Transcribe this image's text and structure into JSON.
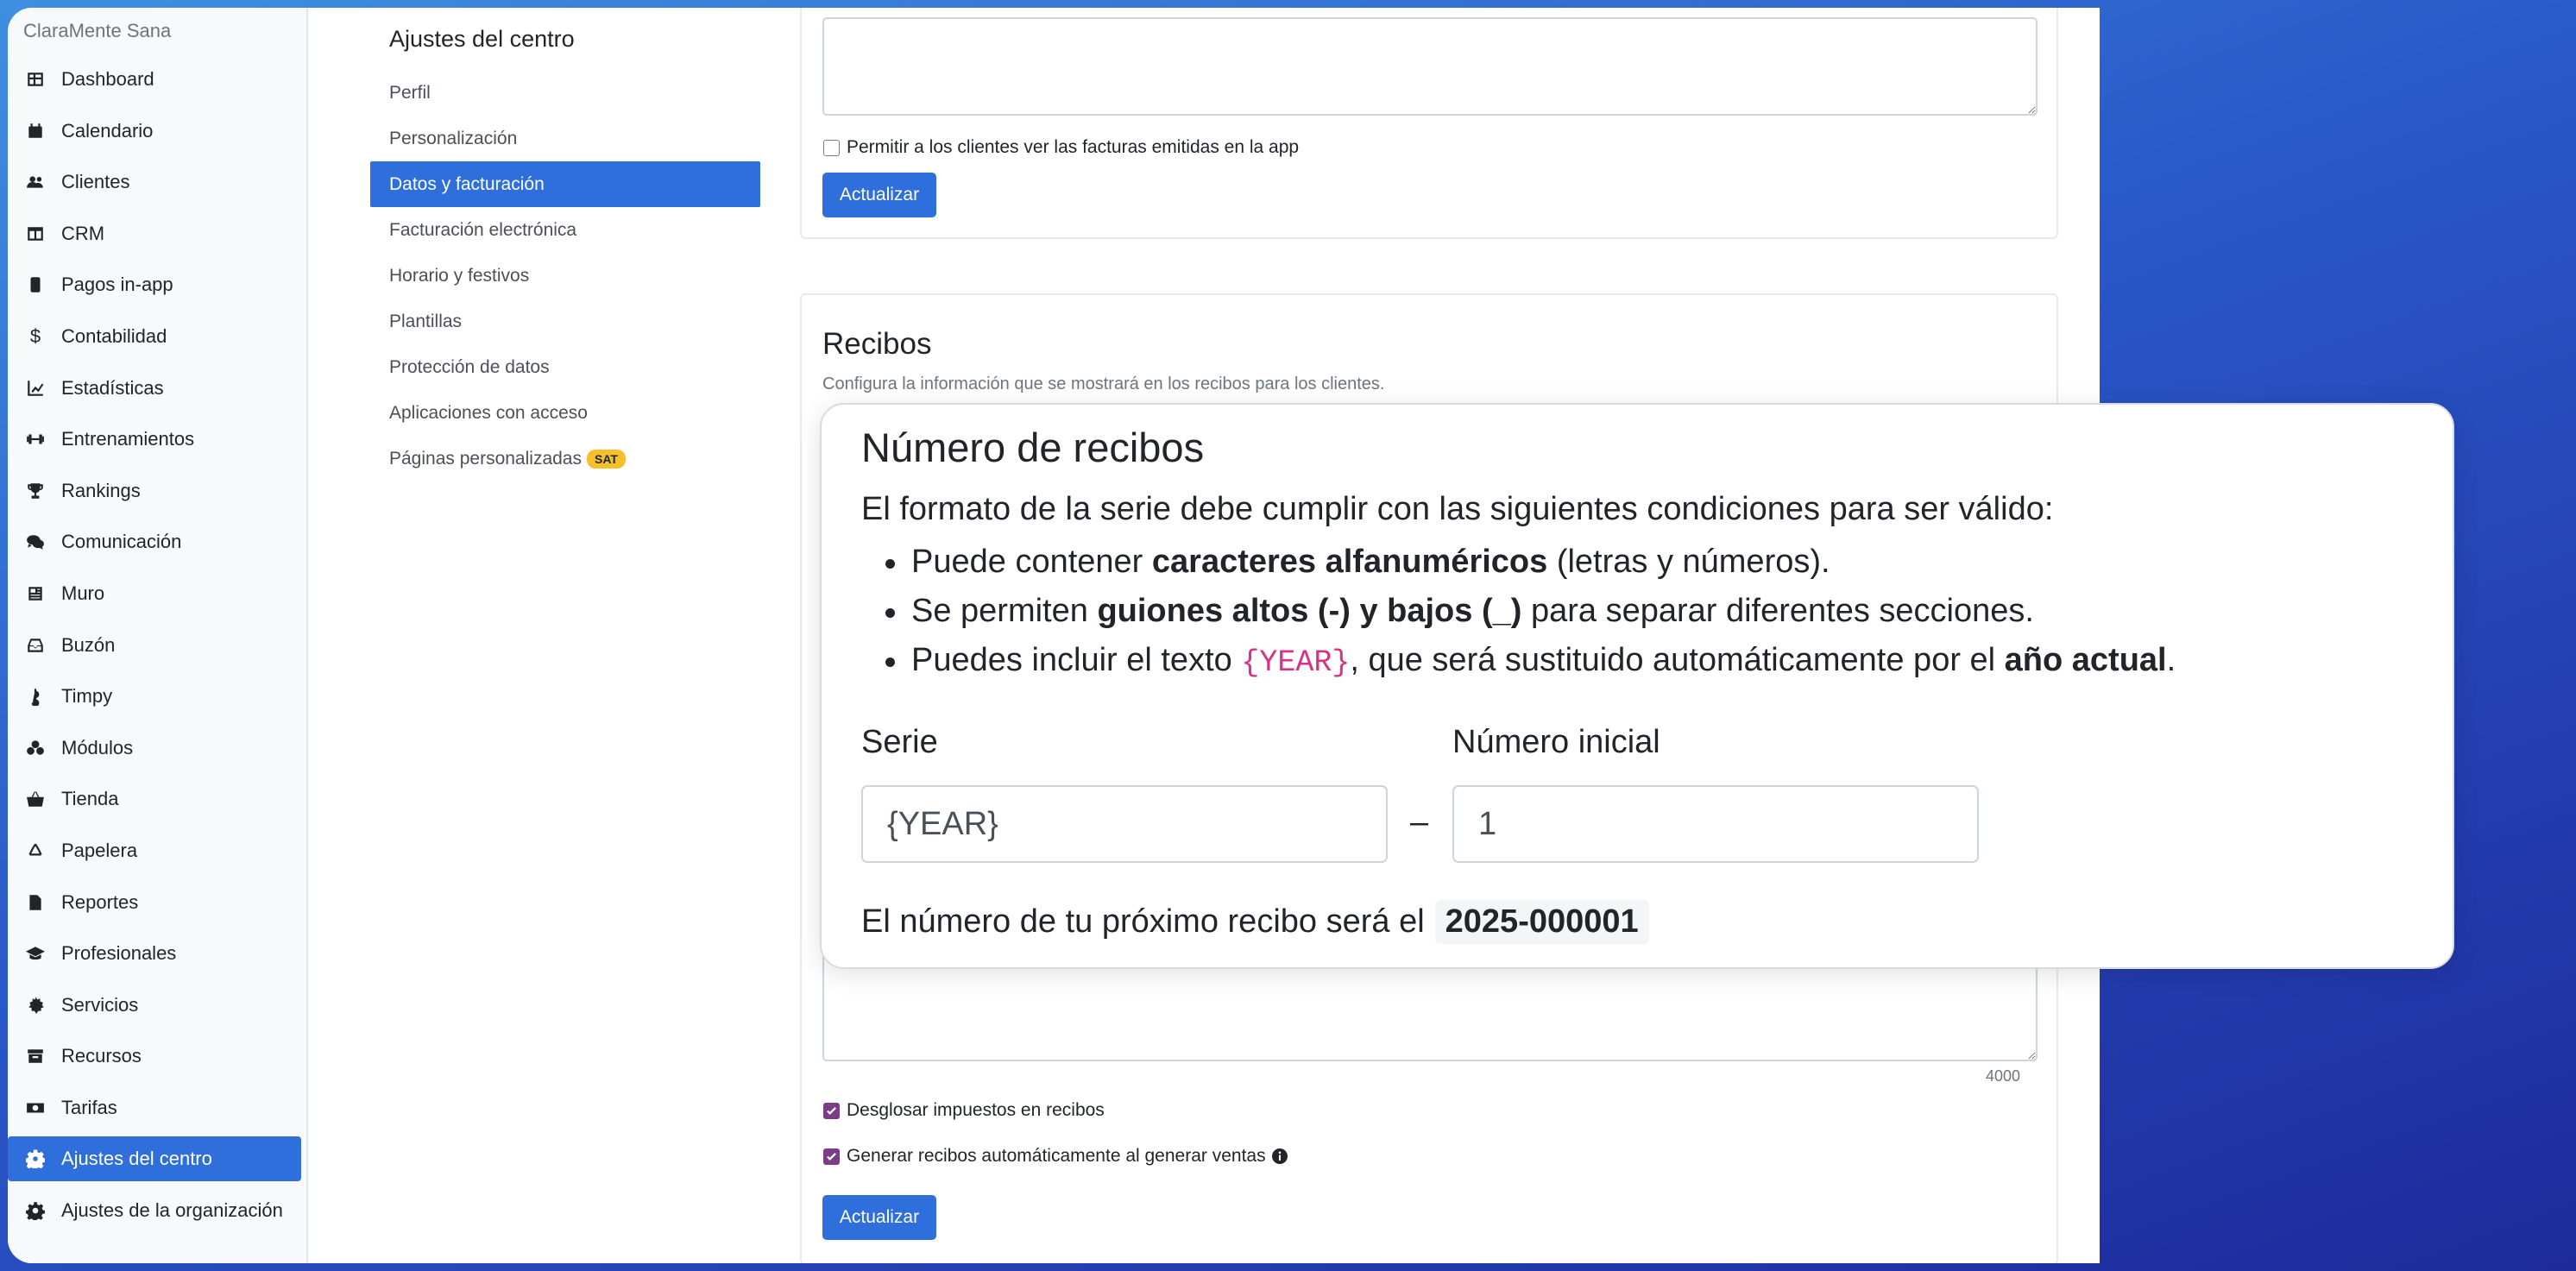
{
  "brand": "ClaraMente Sana",
  "nav": [
    {
      "label": "Dashboard",
      "icon": "table-icon"
    },
    {
      "label": "Calendario",
      "icon": "calendar-icon"
    },
    {
      "label": "Clientes",
      "icon": "users-icon"
    },
    {
      "label": "CRM",
      "icon": "columns-icon"
    },
    {
      "label": "Pagos in-app",
      "icon": "phone-icon"
    },
    {
      "label": "Contabilidad",
      "icon": "dollar-icon"
    },
    {
      "label": "Estadísticas",
      "icon": "chart-icon"
    },
    {
      "label": "Entrenamientos",
      "icon": "dumbbell-icon"
    },
    {
      "label": "Rankings",
      "icon": "trophy-icon"
    },
    {
      "label": "Comunicación",
      "icon": "comments-icon"
    },
    {
      "label": "Muro",
      "icon": "newspaper-icon"
    },
    {
      "label": "Buzón",
      "icon": "inbox-icon"
    },
    {
      "label": "Timpy",
      "icon": "hook-icon"
    },
    {
      "label": "Módulos",
      "icon": "cubes-icon"
    },
    {
      "label": "Tienda",
      "icon": "basket-icon"
    },
    {
      "label": "Papelera",
      "icon": "recycle-icon"
    },
    {
      "label": "Reportes",
      "icon": "file-icon"
    },
    {
      "label": "Profesionales",
      "icon": "graduation-cap-icon"
    },
    {
      "label": "Servicios",
      "icon": "certificate-icon"
    },
    {
      "label": "Recursos",
      "icon": "archive-icon"
    },
    {
      "label": "Tarifas",
      "icon": "money-bill-icon"
    },
    {
      "label": "Ajustes del centro",
      "icon": "gear-icon",
      "active": true
    },
    {
      "label": "Ajustes de la organización",
      "icon": "gear-icon"
    }
  ],
  "settings_menu": {
    "title": "Ajustes del centro",
    "items": [
      {
        "label": "Perfil"
      },
      {
        "label": "Personalización"
      },
      {
        "label": "Datos y facturación",
        "active": true
      },
      {
        "label": "Facturación electrónica"
      },
      {
        "label": "Horario y festivos"
      },
      {
        "label": "Plantillas"
      },
      {
        "label": "Protección de datos"
      },
      {
        "label": "Aplicaciones con acceso"
      },
      {
        "label": "Páginas personalizadas",
        "badge": "SAT"
      }
    ]
  },
  "invoices_card": {
    "checkbox_label": "Permitir a los clientes ver las facturas emitidas en la app",
    "checkbox_checked": false,
    "update_label": "Actualizar"
  },
  "receipts_card": {
    "title": "Recibos",
    "description": "Configura la información que se mostrará en los recibos para los clientes.",
    "counter": "4000",
    "breakdown_label": "Desglosar impuestos en recibos",
    "breakdown_checked": true,
    "auto_label": "Generar recibos automáticamente al generar ventas",
    "auto_checked": true,
    "update_label": "Actualizar"
  },
  "popup": {
    "title": "Número de recibos",
    "intro": "El formato de la serie debe cumplir con las siguientes condiciones para ser válido:",
    "rules": {
      "r1_pre": "Puede contener ",
      "r1_bold": "caracteres alfanuméricos",
      "r1_post": " (letras y números).",
      "r2_pre": "Se permiten ",
      "r2_bold": "guiones altos (-) y bajos (_)",
      "r2_post": " para separar diferentes secciones.",
      "r3_pre": "Puedes incluir el texto ",
      "r3_code": "{YEAR}",
      "r3_mid": ", que será sustituido automáticamente por el ",
      "r3_bold": "año actual",
      "r3_post": "."
    },
    "serie_label": "Serie",
    "serie_value": "{YEAR}",
    "dash": "–",
    "start_label": "Número inicial",
    "start_value": "1",
    "next_text": "El número de tu próximo recibo será el",
    "next_value": "2025-000001"
  },
  "colors": {
    "accent": "#2f6fdb",
    "checkbox": "#7a3d86",
    "badge": "#f5c02b",
    "code": "#d63384"
  }
}
